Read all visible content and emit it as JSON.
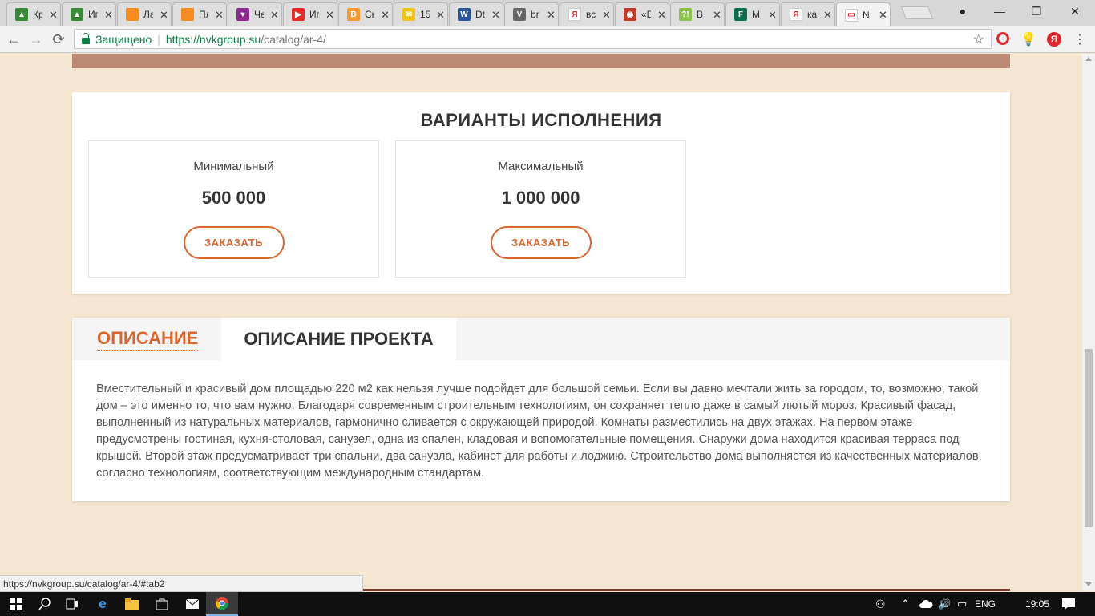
{
  "browser": {
    "tabs": [
      {
        "title": "Кр",
        "fav_color": "#3a8a3a",
        "fav_glyph": "▲"
      },
      {
        "title": "Ип",
        "fav_color": "#3a8a3a",
        "fav_glyph": "▲"
      },
      {
        "title": "Ла",
        "fav_color": "#f68b1f",
        "fav_glyph": ""
      },
      {
        "title": "Пл",
        "fav_color": "#f68b1f",
        "fav_glyph": ""
      },
      {
        "title": "Че",
        "fav_color": "#8e2a8e",
        "fav_glyph": "♥"
      },
      {
        "title": "Ип",
        "fav_color": "#e52d27",
        "fav_glyph": "▶"
      },
      {
        "title": "Ск",
        "fav_color": "#f79a32",
        "fav_glyph": "B"
      },
      {
        "title": "15",
        "fav_color": "#f1c40f",
        "fav_glyph": "✉"
      },
      {
        "title": "Dt",
        "fav_color": "#2b579a",
        "fav_glyph": "W"
      },
      {
        "title": "br",
        "fav_color": "#666666",
        "fav_glyph": "V"
      },
      {
        "title": "вс",
        "fav_color": "#ffffff",
        "fav_glyph": "Я"
      },
      {
        "title": "«Е",
        "fav_color": "#c0392b",
        "fav_glyph": "◉"
      },
      {
        "title": "В",
        "fav_color": "#8bc34a",
        "fav_glyph": "?!"
      },
      {
        "title": "М",
        "fav_color": "#0b6e4f",
        "fav_glyph": "F"
      },
      {
        "title": "ка",
        "fav_color": "#ffffff",
        "fav_glyph": "Я"
      },
      {
        "title": "N",
        "fav_color": "#ffffff",
        "fav_glyph": "▭"
      }
    ],
    "active_tab_index": 15,
    "omnibox": {
      "secure_label": "Защищено",
      "url_host": "https://nvkgroup.su",
      "url_path": "/catalog/ar-4/"
    },
    "status_url": "https://nvkgroup.su/catalog/ar-4/#tab2",
    "colors": {
      "accent_orange": "#d9662e",
      "page_bg": "#f4e6d0",
      "brown_bar": "#bc8a74",
      "secure_green": "#0b8043"
    }
  },
  "variants": {
    "title": "ВАРИАНТЫ ИСПОЛНЕНИЯ",
    "cards": [
      {
        "name": "Минимальный",
        "price": "500 000",
        "button": "ЗАКАЗАТЬ"
      },
      {
        "name": "Максимальный",
        "price": "1 000 000",
        "button": "ЗАКАЗАТЬ"
      }
    ]
  },
  "description": {
    "tabs": [
      "ОПИСАНИЕ",
      "ОПИСАНИЕ ПРОЕКТА"
    ],
    "active_tab": 1,
    "text": "Вместительный и красивый дом площадью 220 м2 как нельзя лучше подойдет для большой семьи. Если вы давно мечтали жить за городом, то, возможно, такой дом – это именно то, что вам нужно. Благодаря современным строительным технологиям, он сохраняет тепло даже в самый лютый мороз. Красивый фасад, выполненный из натуральных материалов, гармонично сливается с окружающей природой. Комнаты разместились на двух этажах. На первом этаже предусмотрены гостиная, кухня-столовая, санузел, одна из спален, кладовая и вспомогательные помещения. Снаружи дома находится красивая терраса под крышей. Второй этаж предусматривает три спальни, два санузла, кабинет для работы и лоджию. Строительство дома выполняется из качественных материалов, согласно технологиям, соответствующим международным стандартам."
  },
  "taskbar": {
    "language": "ENG",
    "time": "19:05"
  }
}
